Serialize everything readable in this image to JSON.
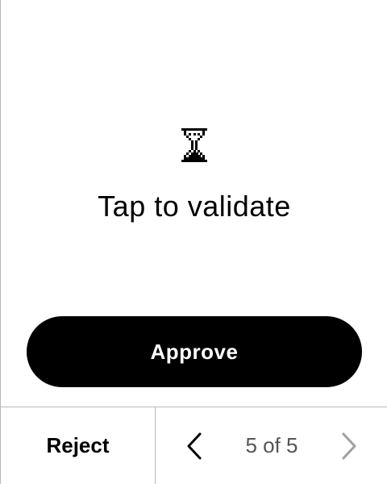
{
  "main": {
    "icon": "hourglass-icon",
    "title": "Tap to validate"
  },
  "actions": {
    "approve_label": "Approve",
    "reject_label": "Reject"
  },
  "pager": {
    "label": "5 of 5",
    "current": 5,
    "total": 5,
    "prev_icon": "chevron-left-icon",
    "next_icon": "chevron-right-icon",
    "prev_enabled": true,
    "next_enabled": false
  },
  "colors": {
    "primary": "#000000",
    "background": "#ffffff",
    "divider": "#b8b8b8",
    "disabled": "#a0a0a0"
  }
}
